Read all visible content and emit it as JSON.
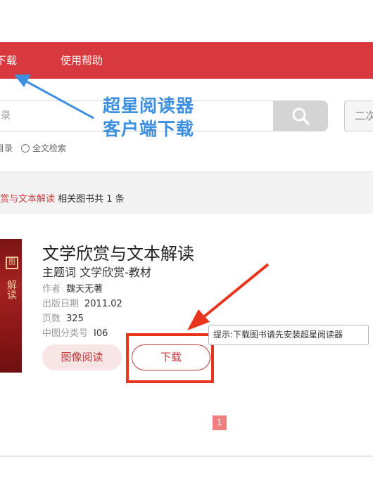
{
  "nav": {
    "download_label": "下载",
    "help_label": "使用帮助",
    "bar_color": "#d8393e"
  },
  "search": {
    "placeholder": "录",
    "button_icon": "search-icon",
    "secondary_button_label": "二次",
    "options": [
      {
        "label": "目录"
      },
      {
        "label": "全文检索"
      }
    ]
  },
  "annotation": {
    "line1": "超星阅读器",
    "line2": "客户端下载",
    "color": "#3d8fe0"
  },
  "results": {
    "query_keyword": "赏与文本解读",
    "summary": "相关图书共 1 条"
  },
  "book": {
    "cover_mark": "图",
    "cover_title": "解读",
    "title": "文学欣赏与文本解读",
    "subject": "主题词 文学欣赏-教材",
    "author_key": "作者",
    "author_value": "魏天无著",
    "date_key": "出版日期",
    "date_value": "2011.02",
    "pages_key": "页数",
    "pages_value": "325",
    "class_key": "中图分类号",
    "class_value": "I06",
    "read_button": "图像阅读",
    "download_button": "下载"
  },
  "tooltip": {
    "text": "提示:下载图书请先安装超星阅读器"
  },
  "pagination": {
    "current_page": "1"
  },
  "colors": {
    "accent_red": "#d8393e",
    "annotation_arrow_red": "#e8351d",
    "annotation_arrow_blue": "#3d8fe0"
  }
}
